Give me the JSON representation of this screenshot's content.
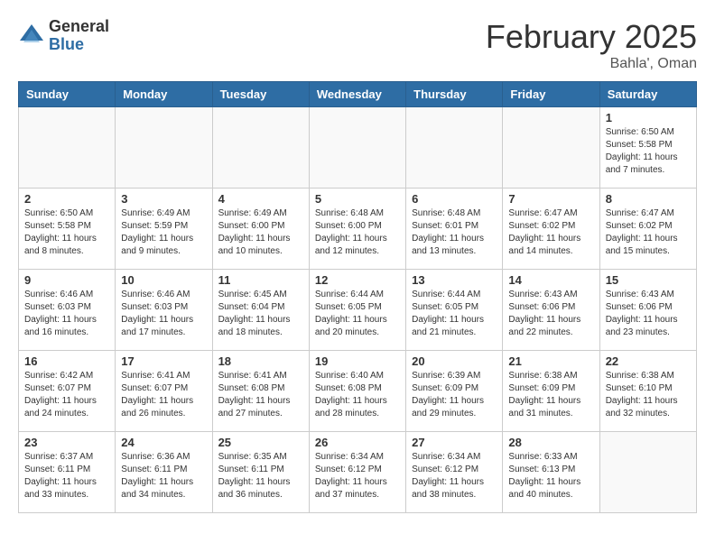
{
  "header": {
    "logo_general": "General",
    "logo_blue": "Blue",
    "title": "February 2025",
    "subtitle": "Bahla', Oman"
  },
  "days_of_week": [
    "Sunday",
    "Monday",
    "Tuesday",
    "Wednesday",
    "Thursday",
    "Friday",
    "Saturday"
  ],
  "weeks": [
    [
      {
        "day": "",
        "info": ""
      },
      {
        "day": "",
        "info": ""
      },
      {
        "day": "",
        "info": ""
      },
      {
        "day": "",
        "info": ""
      },
      {
        "day": "",
        "info": ""
      },
      {
        "day": "",
        "info": ""
      },
      {
        "day": "1",
        "info": "Sunrise: 6:50 AM\nSunset: 5:58 PM\nDaylight: 11 hours and 7 minutes."
      }
    ],
    [
      {
        "day": "2",
        "info": "Sunrise: 6:50 AM\nSunset: 5:58 PM\nDaylight: 11 hours and 8 minutes."
      },
      {
        "day": "3",
        "info": "Sunrise: 6:49 AM\nSunset: 5:59 PM\nDaylight: 11 hours and 9 minutes."
      },
      {
        "day": "4",
        "info": "Sunrise: 6:49 AM\nSunset: 6:00 PM\nDaylight: 11 hours and 10 minutes."
      },
      {
        "day": "5",
        "info": "Sunrise: 6:48 AM\nSunset: 6:00 PM\nDaylight: 11 hours and 12 minutes."
      },
      {
        "day": "6",
        "info": "Sunrise: 6:48 AM\nSunset: 6:01 PM\nDaylight: 11 hours and 13 minutes."
      },
      {
        "day": "7",
        "info": "Sunrise: 6:47 AM\nSunset: 6:02 PM\nDaylight: 11 hours and 14 minutes."
      },
      {
        "day": "8",
        "info": "Sunrise: 6:47 AM\nSunset: 6:02 PM\nDaylight: 11 hours and 15 minutes."
      }
    ],
    [
      {
        "day": "9",
        "info": "Sunrise: 6:46 AM\nSunset: 6:03 PM\nDaylight: 11 hours and 16 minutes."
      },
      {
        "day": "10",
        "info": "Sunrise: 6:46 AM\nSunset: 6:03 PM\nDaylight: 11 hours and 17 minutes."
      },
      {
        "day": "11",
        "info": "Sunrise: 6:45 AM\nSunset: 6:04 PM\nDaylight: 11 hours and 18 minutes."
      },
      {
        "day": "12",
        "info": "Sunrise: 6:44 AM\nSunset: 6:05 PM\nDaylight: 11 hours and 20 minutes."
      },
      {
        "day": "13",
        "info": "Sunrise: 6:44 AM\nSunset: 6:05 PM\nDaylight: 11 hours and 21 minutes."
      },
      {
        "day": "14",
        "info": "Sunrise: 6:43 AM\nSunset: 6:06 PM\nDaylight: 11 hours and 22 minutes."
      },
      {
        "day": "15",
        "info": "Sunrise: 6:43 AM\nSunset: 6:06 PM\nDaylight: 11 hours and 23 minutes."
      }
    ],
    [
      {
        "day": "16",
        "info": "Sunrise: 6:42 AM\nSunset: 6:07 PM\nDaylight: 11 hours and 24 minutes."
      },
      {
        "day": "17",
        "info": "Sunrise: 6:41 AM\nSunset: 6:07 PM\nDaylight: 11 hours and 26 minutes."
      },
      {
        "day": "18",
        "info": "Sunrise: 6:41 AM\nSunset: 6:08 PM\nDaylight: 11 hours and 27 minutes."
      },
      {
        "day": "19",
        "info": "Sunrise: 6:40 AM\nSunset: 6:08 PM\nDaylight: 11 hours and 28 minutes."
      },
      {
        "day": "20",
        "info": "Sunrise: 6:39 AM\nSunset: 6:09 PM\nDaylight: 11 hours and 29 minutes."
      },
      {
        "day": "21",
        "info": "Sunrise: 6:38 AM\nSunset: 6:09 PM\nDaylight: 11 hours and 31 minutes."
      },
      {
        "day": "22",
        "info": "Sunrise: 6:38 AM\nSunset: 6:10 PM\nDaylight: 11 hours and 32 minutes."
      }
    ],
    [
      {
        "day": "23",
        "info": "Sunrise: 6:37 AM\nSunset: 6:11 PM\nDaylight: 11 hours and 33 minutes."
      },
      {
        "day": "24",
        "info": "Sunrise: 6:36 AM\nSunset: 6:11 PM\nDaylight: 11 hours and 34 minutes."
      },
      {
        "day": "25",
        "info": "Sunrise: 6:35 AM\nSunset: 6:11 PM\nDaylight: 11 hours and 36 minutes."
      },
      {
        "day": "26",
        "info": "Sunrise: 6:34 AM\nSunset: 6:12 PM\nDaylight: 11 hours and 37 minutes."
      },
      {
        "day": "27",
        "info": "Sunrise: 6:34 AM\nSunset: 6:12 PM\nDaylight: 11 hours and 38 minutes."
      },
      {
        "day": "28",
        "info": "Sunrise: 6:33 AM\nSunset: 6:13 PM\nDaylight: 11 hours and 40 minutes."
      },
      {
        "day": "",
        "info": ""
      }
    ]
  ]
}
